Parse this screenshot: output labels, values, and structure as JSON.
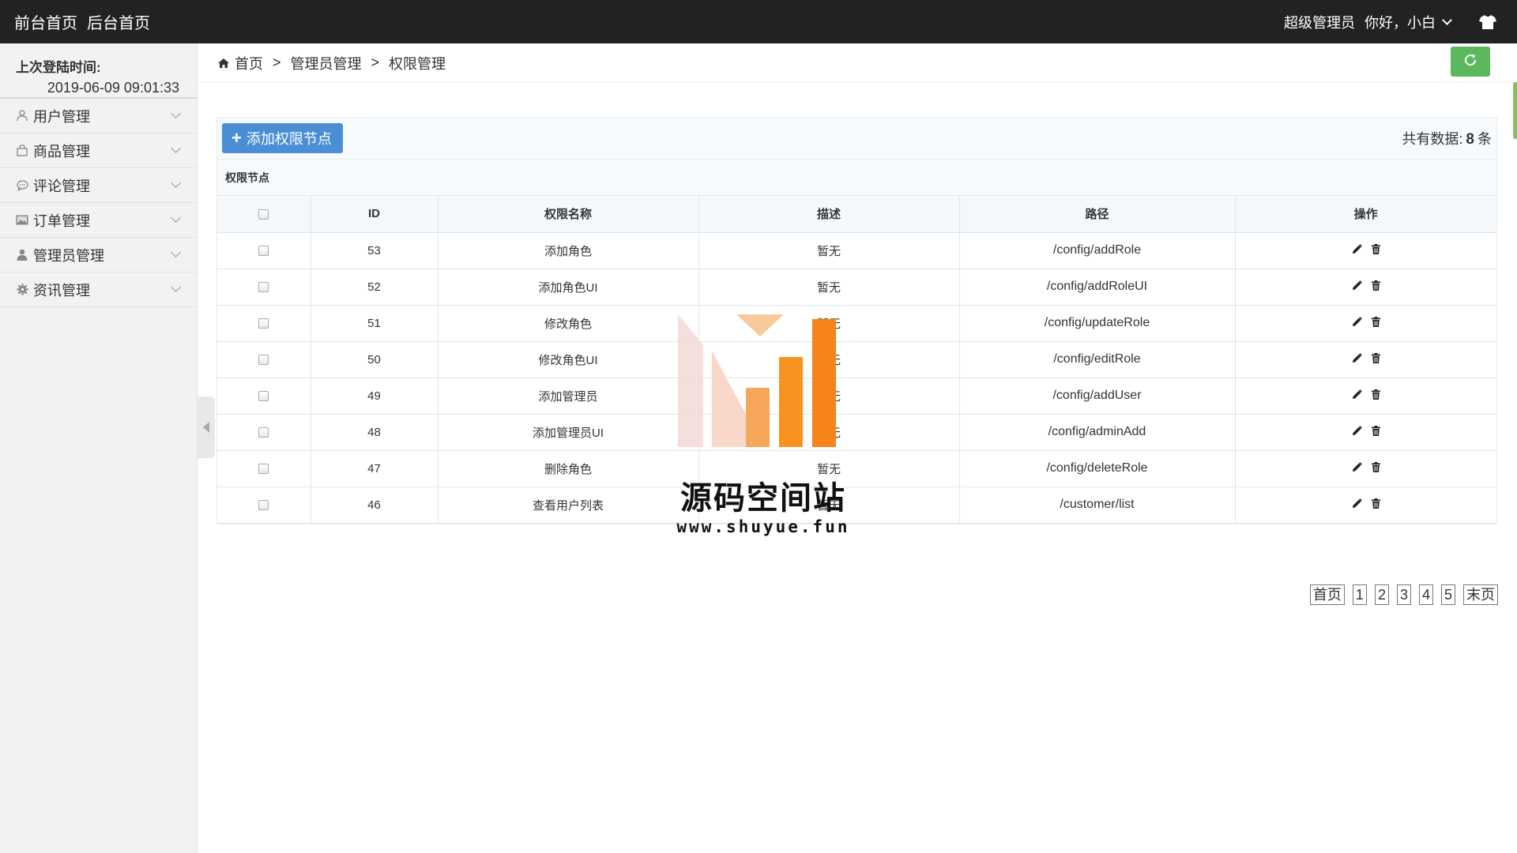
{
  "topbar": {
    "front_home": "前台首页",
    "back_home": "后台首页",
    "role": "超级管理员",
    "greeting": "你好，小白"
  },
  "sidebar": {
    "last_login_label": "上次登陆时间:",
    "last_login_value": "2019-06-09 09:01:33",
    "items": [
      {
        "label": "用户管理",
        "icon": "user-icon"
      },
      {
        "label": "商品管理",
        "icon": "bag-icon"
      },
      {
        "label": "评论管理",
        "icon": "comment-icon"
      },
      {
        "label": "订单管理",
        "icon": "image-icon"
      },
      {
        "label": "管理员管理",
        "icon": "user-solid-icon"
      },
      {
        "label": "资讯管理",
        "icon": "gear-icon"
      }
    ]
  },
  "breadcrumb": {
    "home": "首页",
    "sep1": ">",
    "level1": "管理员管理",
    "sep2": ">",
    "level2": "权限管理"
  },
  "toolbar": {
    "add_label": "添加权限节点",
    "count_prefix": "共有数据:",
    "count_value": "8",
    "count_suffix": "条"
  },
  "panel_title": "权限节点",
  "table": {
    "headers": [
      "ID",
      "权限名称",
      "描述",
      "路径",
      "操作"
    ],
    "rows": [
      {
        "id": "53",
        "name": "添加角色",
        "desc": "暂无",
        "path": "/config/addRole"
      },
      {
        "id": "52",
        "name": "添加角色UI",
        "desc": "暂无",
        "path": "/config/addRoleUI"
      },
      {
        "id": "51",
        "name": "修改角色",
        "desc": "暂无",
        "path": "/config/updateRole"
      },
      {
        "id": "50",
        "name": "修改角色UI",
        "desc": "暂无",
        "path": "/config/editRole"
      },
      {
        "id": "49",
        "name": "添加管理员",
        "desc": "暂无",
        "path": "/config/addUser"
      },
      {
        "id": "48",
        "name": "添加管理员UI",
        "desc": "暂无",
        "path": "/config/adminAdd"
      },
      {
        "id": "47",
        "name": "删除角色",
        "desc": "暂无",
        "path": "/config/deleteRole"
      },
      {
        "id": "46",
        "name": "查看用户列表",
        "desc": "暂无",
        "path": "/customer/list"
      }
    ]
  },
  "pager": {
    "first": "首页",
    "pages": [
      "1",
      "2",
      "3",
      "4",
      "5"
    ],
    "last": "末页"
  },
  "watermark": {
    "title": "源码空间站",
    "url": "www.shuyue.fun"
  },
  "colors": {
    "topbar_bg": "#222222",
    "primary_button": "#4a8fd6",
    "refresh_button": "#5cb85c",
    "watermark_orange": "#f7931e"
  }
}
